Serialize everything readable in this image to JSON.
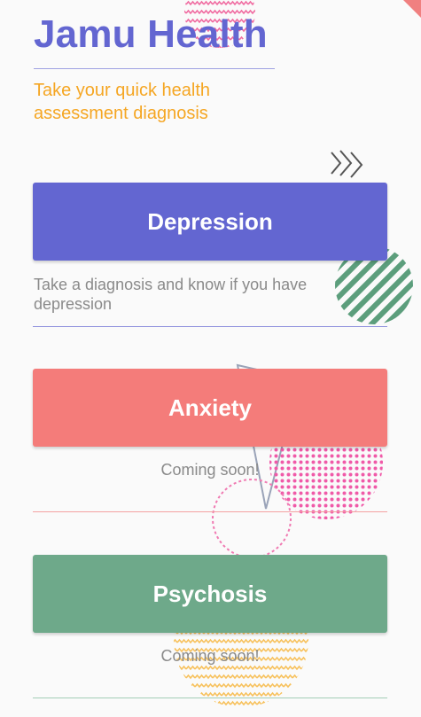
{
  "app": {
    "title": "Jamu Health",
    "subtitle": "Take your quick health assessment diagnosis"
  },
  "cards": [
    {
      "label": "Depression",
      "description": "Take a diagnosis and know if you have depression",
      "color": "#6366d1",
      "rule_color": "#8f91dd"
    },
    {
      "label": "Anxiety",
      "description": "Coming soon!",
      "color": "#f47c7a",
      "rule_color": "#f4a2a1"
    },
    {
      "label": "Psychosis",
      "description": "Coming soon!",
      "color": "#6ea98a",
      "rule_color": "#a3cdb6"
    }
  ],
  "colors": {
    "background": "#fafafa",
    "title": "#6366d1",
    "subtitle": "#f5a623",
    "description": "#8a8a8a"
  }
}
